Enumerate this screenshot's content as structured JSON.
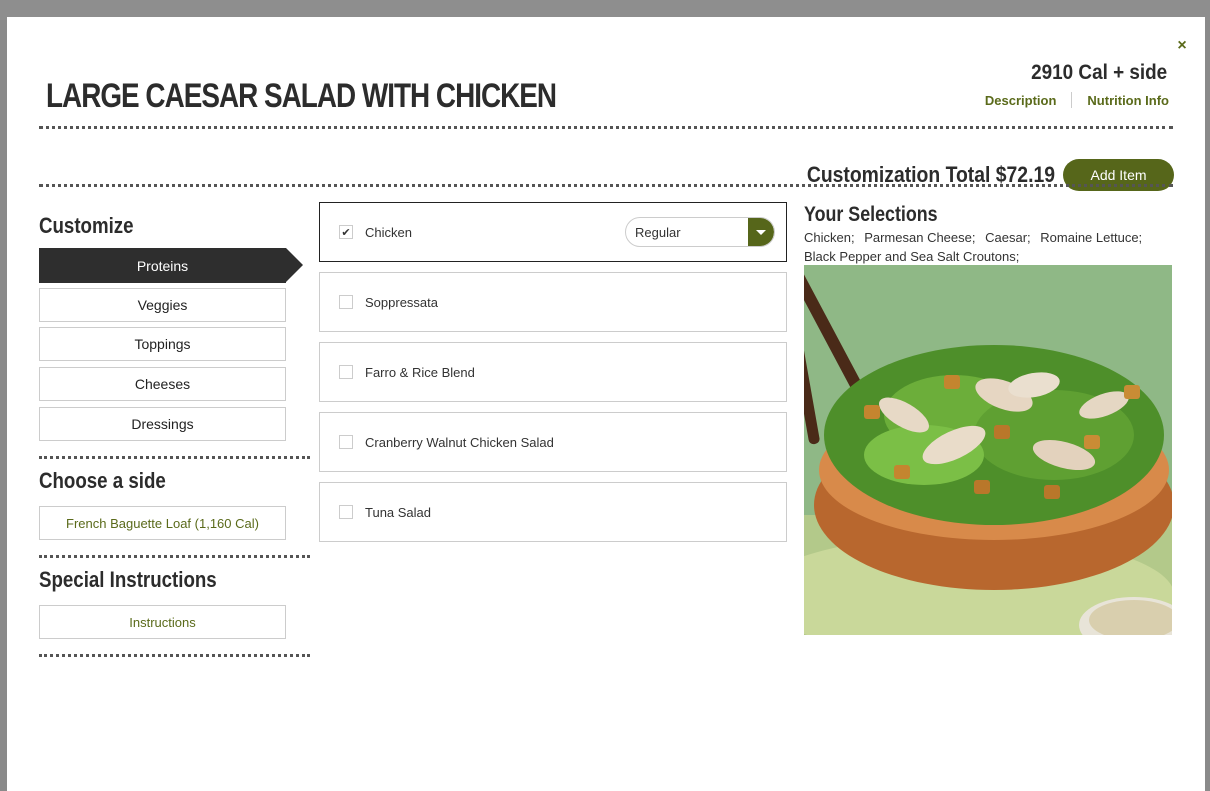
{
  "header": {
    "title": "LARGE CAESAR SALAD WITH CHICKEN",
    "calories": "2910 Cal + side",
    "link_description": "Description",
    "link_nutrition": "Nutrition Info",
    "close": "×"
  },
  "summary": {
    "total": "Customization Total $72.19",
    "add_item": "Add Item"
  },
  "customize": {
    "heading": "Customize",
    "categories": [
      "Proteins",
      "Veggies",
      "Toppings",
      "Cheeses",
      "Dressings"
    ],
    "active_category": "Proteins"
  },
  "side": {
    "heading": "Choose a side",
    "selected": "French Baguette Loaf (1,160 Cal)"
  },
  "special": {
    "heading": "Special Instructions",
    "button": "Instructions"
  },
  "options": [
    {
      "label": "Chicken",
      "checked": true,
      "portion": "Regular"
    },
    {
      "label": "Soppressata",
      "checked": false
    },
    {
      "label": "Farro & Rice Blend",
      "checked": false
    },
    {
      "label": "Cranberry Walnut Chicken Salad",
      "checked": false
    },
    {
      "label": "Tuna Salad",
      "checked": false
    }
  ],
  "selections": {
    "heading": "Your Selections",
    "items": [
      "Chicken;",
      "Parmesan Cheese;",
      "Caesar;",
      "Romaine Lettuce;",
      "Black Pepper and Sea Salt Croutons;"
    ]
  },
  "colors": {
    "accent": "#56661a",
    "dark": "#2e2e2e",
    "text": "#333333"
  },
  "icons": {
    "close": "close-icon",
    "check": "checkmark-icon",
    "dropdown": "chevron-down-icon"
  }
}
